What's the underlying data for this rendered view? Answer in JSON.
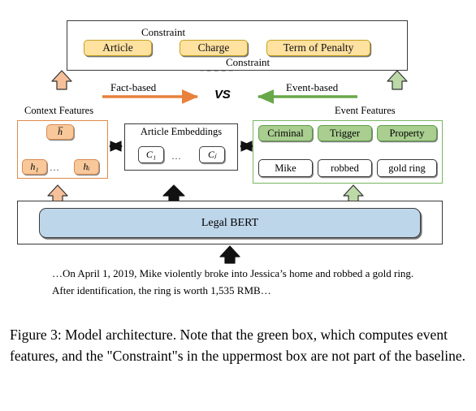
{
  "figure": {
    "caption": "Figure 3: Model architecture. Note that the green box, which computes event features, and the \"Constraint\"s in the uppermost box are not part of the baseline."
  },
  "prediction_box": {
    "nodes": [
      {
        "label": "Article"
      },
      {
        "label": "Charge"
      },
      {
        "label": "Term of Penalty"
      }
    ],
    "edges": [
      {
        "label": "Constraint",
        "style": "solid",
        "from": "Article",
        "to": "Charge"
      },
      {
        "label": "Constraint",
        "style": "dashed",
        "from": "Article",
        "to": "Term of Penalty"
      }
    ]
  },
  "comparison": {
    "left_label": "Fact-based",
    "right_label": "Event-based",
    "versus": "VS",
    "left_color": "#e8813c",
    "right_color": "#68a84a"
  },
  "context_features": {
    "caption": "Context Features",
    "pooled": "h̅",
    "tokens": [
      "h₁",
      "hᵢ"
    ],
    "ellipsis": "…",
    "border_color": "#e08b4a",
    "node_color": "#f8c89b"
  },
  "article_embeddings": {
    "title": "Article Embeddings",
    "items": [
      "C₁",
      "Cⱼ"
    ],
    "ellipsis": "…"
  },
  "event_features": {
    "caption": "Event Features",
    "border_color": "#7ab563",
    "node_color": "#a9ce90",
    "roles": [
      "Criminal",
      "Trigger",
      "Property"
    ],
    "mentions": [
      "Mike",
      "robbed",
      "gold ring"
    ]
  },
  "encoder": {
    "label": "Legal BERT",
    "color": "#bed6ea"
  },
  "input": {
    "text": "…On April 1, 2019, Mike violently broke into Jessica’s home and robbed a gold ring. After identification, the ring is worth 1,535 RMB…"
  }
}
